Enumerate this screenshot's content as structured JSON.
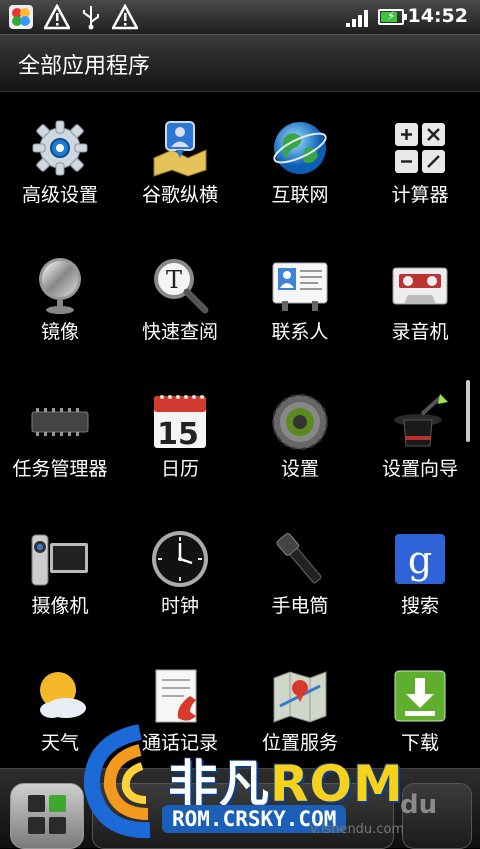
{
  "status_bar": {
    "time": "14:52",
    "icons": [
      "app-notification-icon",
      "warning-icon",
      "usb-icon",
      "warning-icon",
      "signal-icon",
      "battery-charging-icon"
    ],
    "battery_level_fraction": 0.8
  },
  "header": {
    "title": "全部应用程序"
  },
  "apps": [
    {
      "label": "高级设置",
      "icon": "gear-icon"
    },
    {
      "label": "谷歌纵横",
      "icon": "latitude-icon"
    },
    {
      "label": "互联网",
      "icon": "globe-icon"
    },
    {
      "label": "计算器",
      "icon": "calculator-icon"
    },
    {
      "label": "镜像",
      "icon": "mirror-icon"
    },
    {
      "label": "快速查阅",
      "icon": "magnifier-icon"
    },
    {
      "label": "联系人",
      "icon": "contacts-card-icon"
    },
    {
      "label": "录音机",
      "icon": "cassette-icon"
    },
    {
      "label": "任务管理器",
      "icon": "chip-icon"
    },
    {
      "label": "日历",
      "icon": "calendar-icon",
      "icon_text": "15"
    },
    {
      "label": "设置",
      "icon": "settings-gear-icon"
    },
    {
      "label": "设置向导",
      "icon": "magic-hat-icon"
    },
    {
      "label": "摄像机",
      "icon": "camcorder-icon"
    },
    {
      "label": "时钟",
      "icon": "clock-icon"
    },
    {
      "label": "手电筒",
      "icon": "flashlight-icon"
    },
    {
      "label": "搜索",
      "icon": "search-g-icon",
      "icon_text": "g"
    },
    {
      "label": "天气",
      "icon": "weather-icon"
    },
    {
      "label": "通话记录",
      "icon": "call-log-icon"
    },
    {
      "label": "位置服务",
      "icon": "location-map-icon"
    },
    {
      "label": "下载",
      "icon": "download-arrow-icon"
    }
  ],
  "watermark": {
    "brand_cn": "非凡",
    "brand_en": "ROM",
    "url": "ROM.CRSKY.COM",
    "partial_text": "du",
    "partial_site": "v.ishendu.com"
  },
  "colors": {
    "background": "#000000",
    "watermark_blue": "#1b5fb8",
    "watermark_yellow": "#f7d21d"
  }
}
